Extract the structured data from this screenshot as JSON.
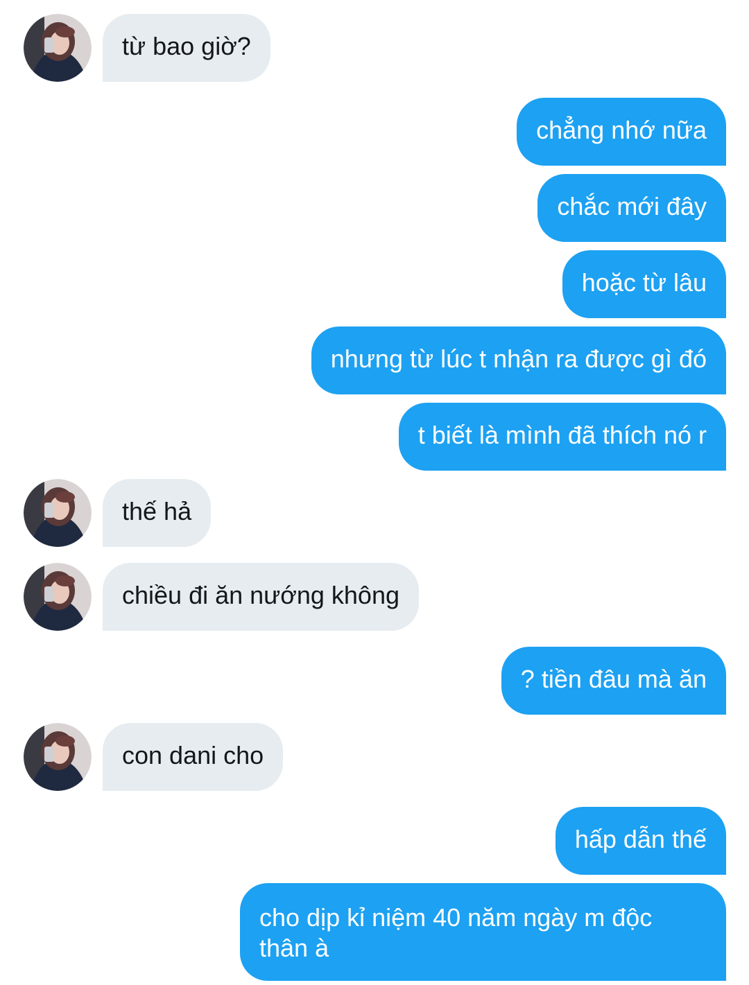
{
  "conversation": {
    "messages": [
      {
        "sender": "them",
        "text": "từ bao giờ?"
      },
      {
        "sender": "me",
        "text": "chẳng nhớ nữa"
      },
      {
        "sender": "me",
        "text": "chắc mới đây"
      },
      {
        "sender": "me",
        "text": "hoặc từ lâu"
      },
      {
        "sender": "me",
        "text": "nhưng từ lúc t nhận ra được gì đó"
      },
      {
        "sender": "me",
        "text": "t biết là mình đã thích nó r"
      },
      {
        "sender": "them",
        "text": "thế hả"
      },
      {
        "sender": "them",
        "text": "chiều đi ăn nướng không"
      },
      {
        "sender": "me",
        "text": "? tiền đâu mà ăn"
      },
      {
        "sender": "them",
        "text": "con dani cho"
      },
      {
        "sender": "me",
        "text": "hấp dẫn thế"
      },
      {
        "sender": "me",
        "text": "cho dịp kỉ niệm 40 năm ngày m độc thân à"
      }
    ]
  },
  "colors": {
    "incoming_bubble": "#e6ecf0",
    "incoming_text": "#14171a",
    "outgoing_bubble": "#1da1f2",
    "outgoing_text": "#ffffff"
  }
}
